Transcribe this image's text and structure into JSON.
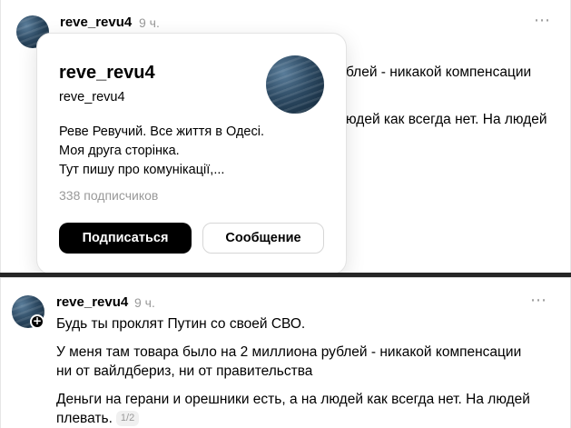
{
  "top_post": {
    "username": "reve_revu4",
    "time": "9 ч.",
    "more_icon": "⋯",
    "partial_line_1": "блей - никакой компенсации",
    "partial_line_2": "юдей как всегда нет. На людей"
  },
  "profile_card": {
    "name": "reve_revu4",
    "handle": "reve_revu4",
    "bio_lines": [
      "Реве Ревучий. Все життя в Одесі.",
      "Моя друга сторінка.",
      "Тут пишу про комунікації,..."
    ],
    "followers": "338 подписчиков",
    "follow_button": "Подписаться",
    "message_button": "Сообщение"
  },
  "bottom_post": {
    "username": "reve_revu4",
    "time": "9 ч.",
    "more_icon": "⋯",
    "paragraph_1": "Будь ты проклят Путин со своей СВО.",
    "paragraph_2_line_1": "У меня там товара было на 2 миллиона рублей - никакой компенсации",
    "paragraph_2_line_2": "ни от вайлдбериз, ни от правительства",
    "paragraph_3_line_1": "Деньги на герани и орешники есть, а на людей как всегда нет. На людей",
    "paragraph_3_line_2": "плевать.",
    "page_counter": "1/2"
  }
}
